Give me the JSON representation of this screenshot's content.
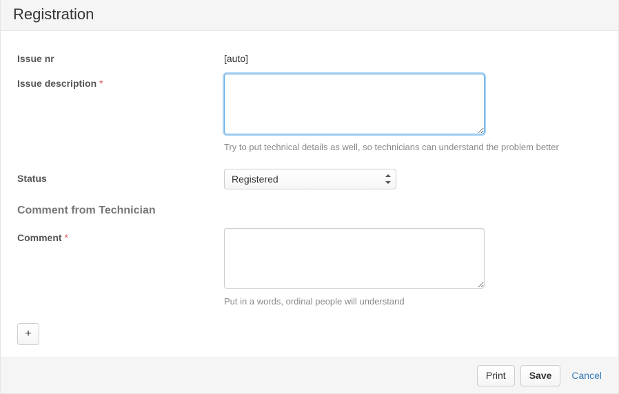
{
  "header": {
    "title": "Registration"
  },
  "fields": {
    "issue_nr": {
      "label": "Issue nr",
      "value": "[auto]"
    },
    "issue_description": {
      "label": "Issue description",
      "required_marker": "*",
      "value": "",
      "help": "Try to put technical details as well, so technicians can understand the problem better"
    },
    "status": {
      "label": "Status",
      "value": "Registered"
    }
  },
  "section": {
    "comment_from_technician": "Comment from Technician"
  },
  "comment": {
    "label": "Comment",
    "required_marker": "*",
    "value": "",
    "help": "Put in a words, ordinal people will understand"
  },
  "buttons": {
    "add": "+",
    "print": "Print",
    "save": "Save",
    "cancel": "Cancel"
  }
}
